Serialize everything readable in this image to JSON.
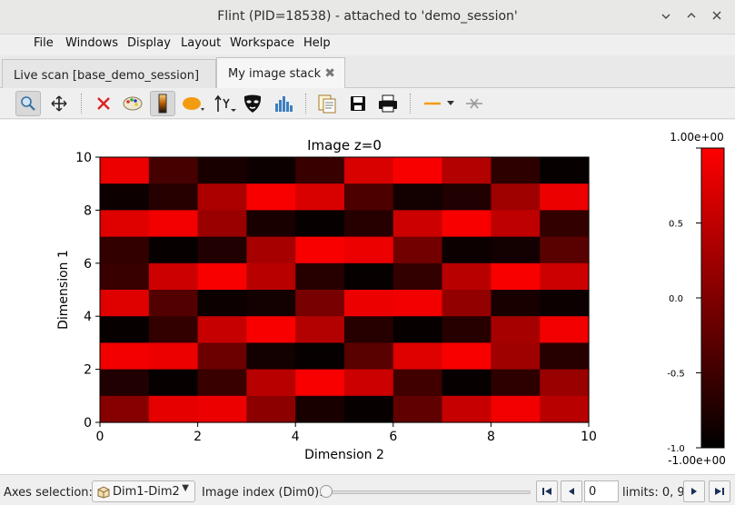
{
  "window": {
    "title": "Flint (PID=18538) - attached to 'demo_session'",
    "controls": [
      "minimize",
      "maximize",
      "close"
    ]
  },
  "menu": {
    "items": [
      {
        "label": "File"
      },
      {
        "label": "Windows"
      },
      {
        "label": "Display"
      },
      {
        "label": "Layout"
      },
      {
        "label": "Workspace"
      },
      {
        "label": "Help"
      }
    ]
  },
  "tabs": [
    {
      "label": "Live scan [base_demo_session]",
      "active": false
    },
    {
      "label": "My image stack",
      "active": true
    }
  ],
  "toolbar": {
    "buttons": [
      {
        "name": "zoom-icon",
        "pressed": true
      },
      {
        "name": "pan-icon"
      },
      {
        "name": "reset-zoom-icon"
      },
      {
        "name": "colormap-icon"
      },
      {
        "name": "colorbar-icon",
        "pressed": true
      },
      {
        "name": "roi-icon"
      },
      {
        "name": "axis-icon"
      },
      {
        "name": "mask-icon"
      },
      {
        "name": "histogram-icon"
      },
      {
        "name": "copy-icon"
      },
      {
        "name": "save-icon"
      },
      {
        "name": "print-icon"
      },
      {
        "name": "line-style-icon"
      },
      {
        "name": "crosshair-icon"
      }
    ]
  },
  "chart_data": {
    "type": "heatmap",
    "title": "Image z=0",
    "xlabel": "Dimension 2",
    "ylabel": "Dimension 1",
    "xlim": [
      0,
      10
    ],
    "ylim": [
      0,
      10
    ],
    "xticks": [
      "0",
      "2",
      "4",
      "6",
      "8",
      "10"
    ],
    "yticks": [
      "0",
      "2",
      "4",
      "6",
      "8",
      "10"
    ],
    "rows_top_to_bottom": [
      [
        0.85,
        -0.45,
        -0.8,
        -0.9,
        -0.55,
        0.7,
        0.95,
        0.4,
        -0.65,
        -0.95
      ],
      [
        -0.9,
        -0.7,
        0.35,
        0.95,
        0.7,
        -0.4,
        -0.85,
        -0.75,
        0.25,
        0.85
      ],
      [
        0.75,
        0.9,
        0.2,
        -0.8,
        -0.95,
        -0.7,
        0.6,
        0.95,
        0.5,
        -0.6
      ],
      [
        -0.6,
        -0.95,
        -0.75,
        0.3,
        0.95,
        0.85,
        -0.1,
        -0.9,
        -0.85,
        -0.3
      ],
      [
        -0.55,
        0.6,
        0.95,
        0.45,
        -0.7,
        -0.95,
        -0.6,
        0.45,
        0.95,
        0.6
      ],
      [
        0.75,
        -0.35,
        -0.9,
        -0.85,
        -0.05,
        0.85,
        0.9,
        0.15,
        -0.8,
        -0.9
      ],
      [
        -0.95,
        -0.6,
        0.55,
        0.95,
        0.4,
        -0.7,
        -0.95,
        -0.7,
        0.3,
        0.9
      ],
      [
        0.9,
        0.85,
        -0.15,
        -0.85,
        -0.95,
        -0.3,
        0.75,
        0.95,
        0.25,
        -0.7
      ],
      [
        -0.75,
        -0.95,
        -0.55,
        0.45,
        0.95,
        0.6,
        -0.5,
        -0.95,
        -0.65,
        0.2
      ],
      [
        0.05,
        0.8,
        0.85,
        0.1,
        -0.8,
        -0.95,
        -0.25,
        0.55,
        0.9,
        0.45
      ]
    ],
    "colorbar": {
      "top_label": "1.00e+00",
      "bottom_label": "-1.00e+00",
      "ticks": [
        {
          "value": 1.0,
          "label": "1.0"
        },
        {
          "value": 0.5,
          "label": "0.5"
        },
        {
          "value": 0.0,
          "label": "0.0"
        },
        {
          "value": -0.5,
          "label": "-0.5"
        },
        {
          "value": -1.0,
          "label": "-1.0"
        }
      ],
      "range": [
        -1,
        1
      ],
      "colormap": "red"
    },
    "grid": false
  },
  "bottom": {
    "axes_selection_label": "Axes selection:",
    "axes_value": "Dim1-Dim2",
    "image_index_label": "Image index (Dim0):",
    "index_value": "0",
    "limits_text": "limits: 0, 9"
  }
}
